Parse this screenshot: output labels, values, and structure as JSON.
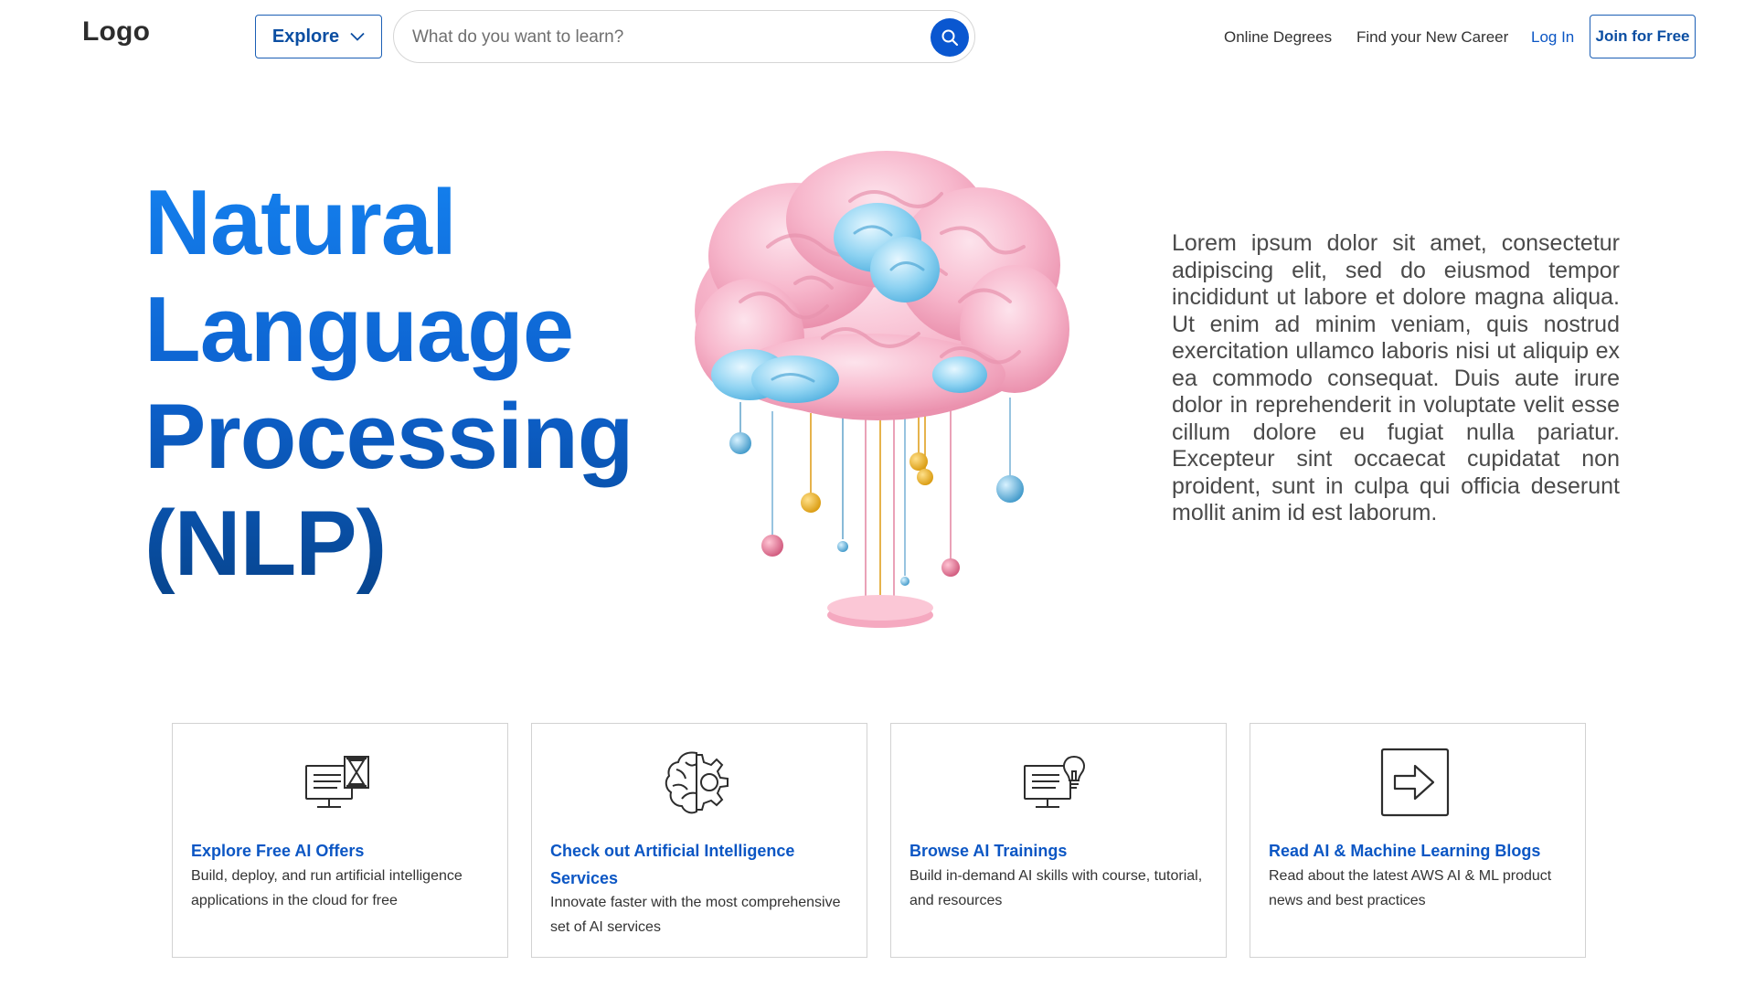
{
  "header": {
    "logo": "Logo",
    "explore_label": "Explore",
    "search_placeholder": "What do you want to learn?",
    "nav": {
      "degrees": "Online Degrees",
      "career": "Find your New Career",
      "login": "Log In",
      "join": "Join for Free"
    }
  },
  "hero": {
    "title_lines": [
      "Natural",
      "Language",
      "Processing",
      "(NLP)"
    ],
    "image_icon": "pink-brain-cloud-illustration",
    "description": "Lorem ipsum dolor sit amet, consectetur adipiscing elit, sed do eiusmod tempor incididunt ut labore et dolore magna aliqua. Ut enim ad minim veniam, quis nostrud exercitation ullamco laboris nisi ut aliquip ex ea commodo consequat. Duis aute irure dolor in reprehenderit in voluptate velit esse cillum dolore eu fugiat nulla pariatur. Excepteur sint occaecat cupidatat non proident, sunt in culpa qui officia deserunt mollit anim id est laborum."
  },
  "cards": [
    {
      "icon": "computer-hourglass-icon",
      "title": "Explore Free AI Offers",
      "description": "Build, deploy, and run artificial intelligence applications in the cloud for free"
    },
    {
      "icon": "brain-gear-icon",
      "title": "Check out Artificial Intelligence Services",
      "description": "Innovate faster with the most comprehensive set of AI services"
    },
    {
      "icon": "computer-lightbulb-icon",
      "title": "Browse AI Trainings",
      "description": "Build in-demand AI skills with course, tutorial, and resources"
    },
    {
      "icon": "arrow-box-icon",
      "title": "Read AI & Machine Learning Blogs",
      "description": "Read about the latest AWS AI & ML product news and best practices"
    }
  ],
  "colors": {
    "brand_blue": "#0b56c4",
    "button_border": "#1b5fb5",
    "search_button": "#0a57d0",
    "title_gradient_top": "#1480ee",
    "title_gradient_bottom": "#07458f"
  }
}
